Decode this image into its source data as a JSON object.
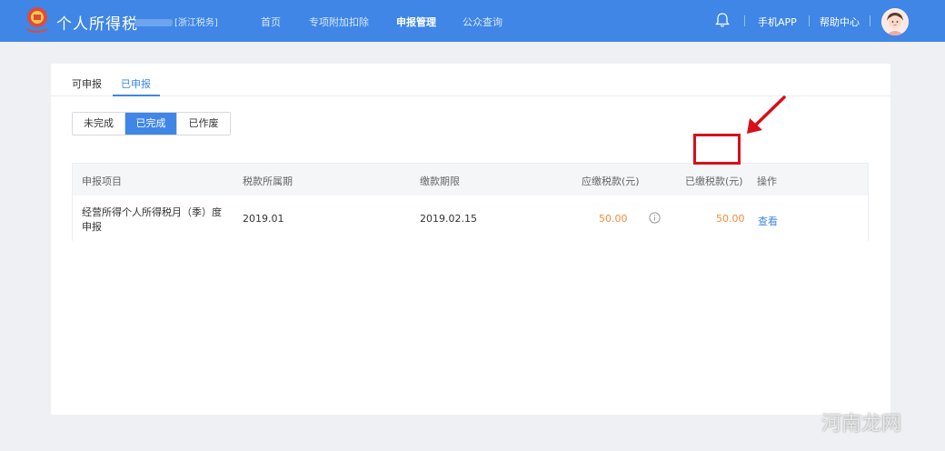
{
  "header": {
    "app_title": "个人所得税",
    "region": "浙江税务",
    "nav": [
      "首页",
      "专项附加扣除",
      "申报管理",
      "公众查询"
    ],
    "active_nav": "申报管理",
    "links": {
      "mobile_app": "手机APP",
      "help": "帮助中心"
    }
  },
  "tabs": {
    "items": [
      "可申报",
      "已申报"
    ],
    "active": "已申报"
  },
  "status_filter": {
    "items": [
      "未完成",
      "已完成",
      "已作废"
    ],
    "active": "已完成"
  },
  "table": {
    "columns": [
      "申报项目",
      "税款所属期",
      "缴款期限",
      "应缴税款(元)",
      "已缴税款(元)",
      "操作"
    ],
    "rows": [
      {
        "item_line1": "经营所得个人所得税月（季）度",
        "item_line2": "申报",
        "period": "2019.01",
        "deadline": "2019.02.15",
        "payable": "50.00",
        "paid": "50.00",
        "action": "查看"
      }
    ]
  },
  "watermark": "河南龙网",
  "colors": {
    "brand": "#3f86e6",
    "amount": "#f08c3a",
    "annotation": "#d7101a"
  }
}
